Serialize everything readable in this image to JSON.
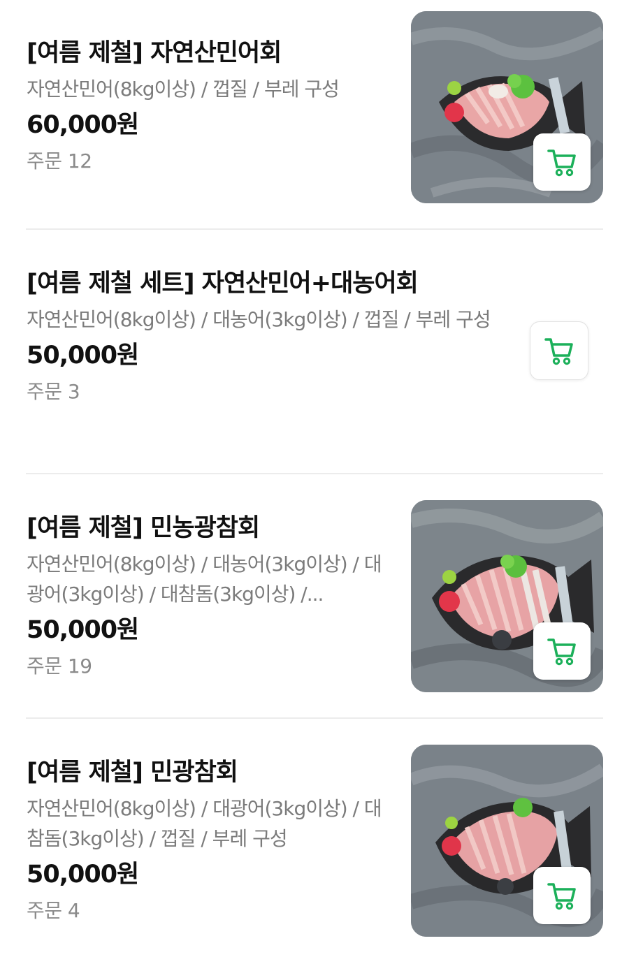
{
  "products": [
    {
      "title": "[여름 제철] 자연산민어회",
      "desc": "자연산민어(8kg이상) / 껍질 / 부레 구성",
      "price": "60,000원",
      "orders": "주문 12",
      "has_image": true
    },
    {
      "title": "[여름 제철 세트] 자연산민어+대농어회",
      "desc": "자연산민어(8kg이상) / 대농어(3kg이상) / 껍질 / 부레 구성",
      "price": "50,000원",
      "orders": "주문 3",
      "has_image": false
    },
    {
      "title": "[여름 제철] 민농광참회",
      "desc": "자연산민어(8kg이상) / 대농어(3kg이상) / 대광어(3kg이상) / 대참돔(3kg이상) /...",
      "price": "50,000원",
      "orders": "주문 19",
      "has_image": true
    },
    {
      "title": "[여름 제철] 민광참회",
      "desc": "자연산민어(8kg이상) / 대광어(3kg이상) / 대참돔(3kg이상) / 껍질 / 부레 구성",
      "price": "50,000원",
      "orders": "주문 4",
      "has_image": true
    }
  ],
  "colors": {
    "accent": "#1cb05a",
    "title": "#111111",
    "desc": "#7b7b7b",
    "orders": "#8a8a8a",
    "divider": "#ececec"
  },
  "icons": {
    "cart": "shopping-cart-icon"
  }
}
